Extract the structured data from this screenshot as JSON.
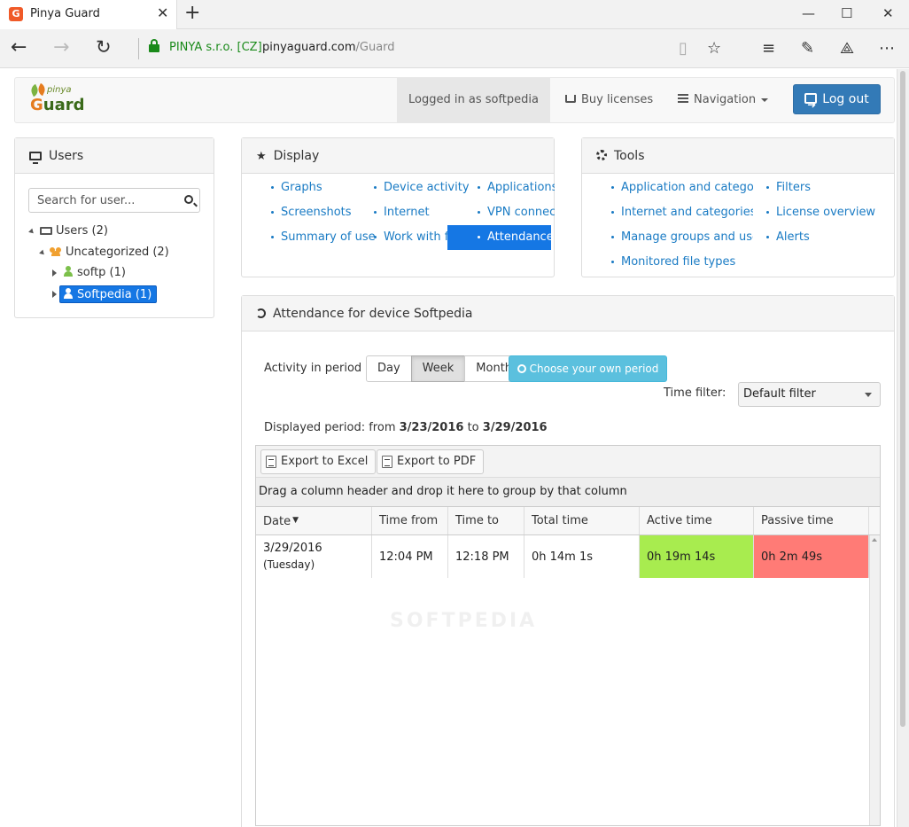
{
  "browser": {
    "tab_title": "Pinya Guard",
    "favicon_letter": "G",
    "cert_label": "PINYA s.r.o. [CZ]",
    "url_host": "pinyaguard.com",
    "url_path": "/Guard"
  },
  "header": {
    "logo_top": "pinya",
    "logo_main_first": "G",
    "logo_main_rest": "uard",
    "logged_in": "Logged in as softpedia",
    "buy_licenses": "Buy licenses",
    "navigation": "Navigation",
    "logout": "Log out"
  },
  "users_panel": {
    "title": "Users",
    "search_placeholder": "Search for user...",
    "tree": {
      "root": "Users (2)",
      "group": "Uncategorized (2)",
      "user1": "softp (1)",
      "user2": "Softpedia (1)"
    }
  },
  "display_panel": {
    "title": "Display",
    "col1": [
      "Graphs",
      "Screenshots",
      "Summary of users"
    ],
    "col2": [
      "Device activity",
      "Internet",
      "Work with files"
    ],
    "col3": [
      "Applications",
      "VPN connections",
      "Attendance"
    ]
  },
  "tools_panel": {
    "title": "Tools",
    "col1": [
      "Application and categories",
      "Internet and categories",
      "Manage groups and users",
      "Monitored file types"
    ],
    "col2": [
      "Filters",
      "License overview",
      "Alerts"
    ]
  },
  "attendance": {
    "title": "Attendance for device Softpedia",
    "activity_label": "Activity in period",
    "period_buttons": [
      "Day",
      "Week",
      "Month"
    ],
    "active_period": "Week",
    "choose_period": "Choose your own period",
    "time_filter_label": "Time filter:",
    "time_filter_value": "Default filter",
    "displayed_prefix": "Displayed period: from ",
    "from_date": "3/23/2016",
    "to_word": " to ",
    "to_date": "3/29/2016",
    "export_excel": "Export to Excel",
    "export_pdf": "Export to PDF",
    "group_hint": "Drag a column header and drop it here to group by that column",
    "columns": [
      "Date",
      "Time from",
      "Time to",
      "Total time",
      "Active time",
      "Passive time"
    ],
    "rows": [
      {
        "date": "3/29/2016",
        "day": "(Tuesday)",
        "time_from": "12:04 PM",
        "time_to": "12:18 PM",
        "total": "0h 14m 1s",
        "active": "0h 19m 14s",
        "passive": "0h 2m 49s"
      }
    ]
  },
  "watermark": "SOFTPEDIA",
  "colors": {
    "active_cell": "#a8ec4f",
    "passive_cell": "#ff7b76",
    "link": "#1a7bc4",
    "selected": "#1577e4",
    "logout": "#337ab7",
    "info_button": "#5bc0de"
  }
}
